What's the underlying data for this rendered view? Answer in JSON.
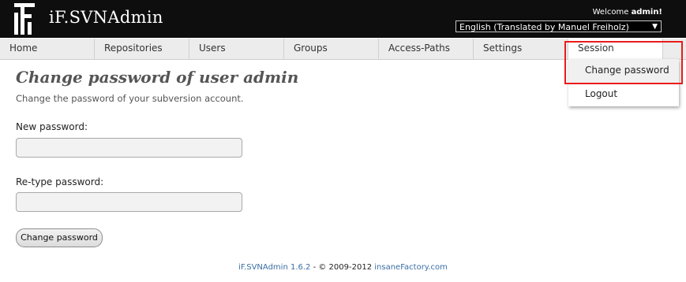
{
  "app": {
    "title": "iF.SVNAdmin"
  },
  "header": {
    "welcome_prefix": "Welcome",
    "welcome_user": "admin!",
    "language": "English (Translated by Manuel Freiholz)"
  },
  "nav": {
    "items": [
      {
        "label": "Home"
      },
      {
        "label": "Repositories"
      },
      {
        "label": "Users"
      },
      {
        "label": "Groups"
      },
      {
        "label": "Access-Paths"
      },
      {
        "label": "Settings"
      },
      {
        "label": "Session"
      }
    ],
    "session_menu": [
      {
        "label": "Change password"
      },
      {
        "label": "Logout"
      }
    ]
  },
  "page": {
    "title": "Change password of user admin",
    "subtitle": "Change the password of your subversion account.",
    "new_password_label": "New password:",
    "retype_password_label": "Re-type password:",
    "submit_label": "Change password"
  },
  "footer": {
    "product": "iF.SVNAdmin 1.6.2",
    "copyright": " - © 2009-2012 ",
    "company": "insaneFactory.com"
  },
  "colors": {
    "header_bg": "#0e0e0e",
    "highlight": "#ea1b1b",
    "link": "#3a6ea5"
  }
}
